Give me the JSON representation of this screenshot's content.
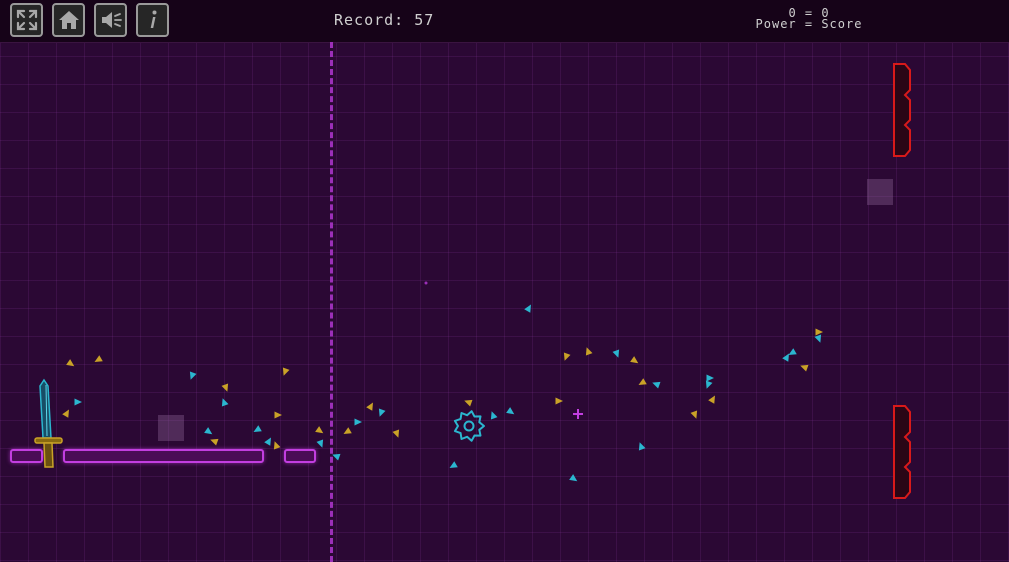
{
  "toolbar": {
    "buttons": [
      {
        "name": "fullscreen-button",
        "icon": "fullscreen-icon"
      },
      {
        "name": "home-button",
        "icon": "home-icon"
      },
      {
        "name": "sound-button",
        "icon": "speaker-icon"
      },
      {
        "name": "info-button",
        "icon": "info-icon"
      }
    ]
  },
  "hud": {
    "record_text": "Record: 57",
    "score_values": "0 = 0",
    "score_labels": "Power = Score"
  },
  "colors": {
    "background": "#2b0834",
    "neon_magenta": "#c23ee0",
    "red_gate": "#d81a1a",
    "cyan": "#2bb6cf",
    "gold": "#c9a227"
  },
  "particles": {
    "cyan": [
      [
        78,
        402,
        0
      ],
      [
        192,
        376,
        0
      ],
      [
        224,
        402,
        0
      ],
      [
        209,
        432,
        0
      ],
      [
        257,
        430,
        0
      ],
      [
        269,
        441,
        0
      ],
      [
        321,
        444,
        0
      ],
      [
        336,
        456,
        0
      ],
      [
        358,
        422,
        0
      ],
      [
        381,
        413,
        0
      ],
      [
        493,
        415,
        0
      ],
      [
        511,
        412,
        0
      ],
      [
        453,
        466,
        0
      ],
      [
        529,
        308,
        0
      ],
      [
        617,
        354,
        0
      ],
      [
        656,
        384,
        0
      ],
      [
        710,
        378,
        0
      ],
      [
        708,
        385,
        0
      ],
      [
        641,
        446,
        0
      ],
      [
        574,
        479,
        0
      ],
      [
        792,
        353,
        0
      ],
      [
        787,
        357,
        0
      ],
      [
        819,
        339,
        0
      ]
    ],
    "gold": [
      [
        71,
        364,
        0
      ],
      [
        98,
        360,
        0
      ],
      [
        67,
        413,
        0
      ],
      [
        226,
        388,
        0
      ],
      [
        214,
        441,
        0
      ],
      [
        278,
        415,
        0
      ],
      [
        285,
        372,
        0
      ],
      [
        276,
        445,
        0
      ],
      [
        320,
        431,
        0
      ],
      [
        347,
        432,
        0
      ],
      [
        371,
        406,
        0
      ],
      [
        397,
        434,
        0
      ],
      [
        468,
        402,
        0
      ],
      [
        559,
        401,
        0
      ],
      [
        566,
        357,
        0
      ],
      [
        588,
        351,
        0
      ],
      [
        635,
        361,
        0
      ],
      [
        642,
        383,
        0
      ],
      [
        713,
        399,
        0
      ],
      [
        695,
        415,
        0
      ],
      [
        804,
        367,
        0
      ],
      [
        819,
        332,
        0
      ]
    ]
  }
}
